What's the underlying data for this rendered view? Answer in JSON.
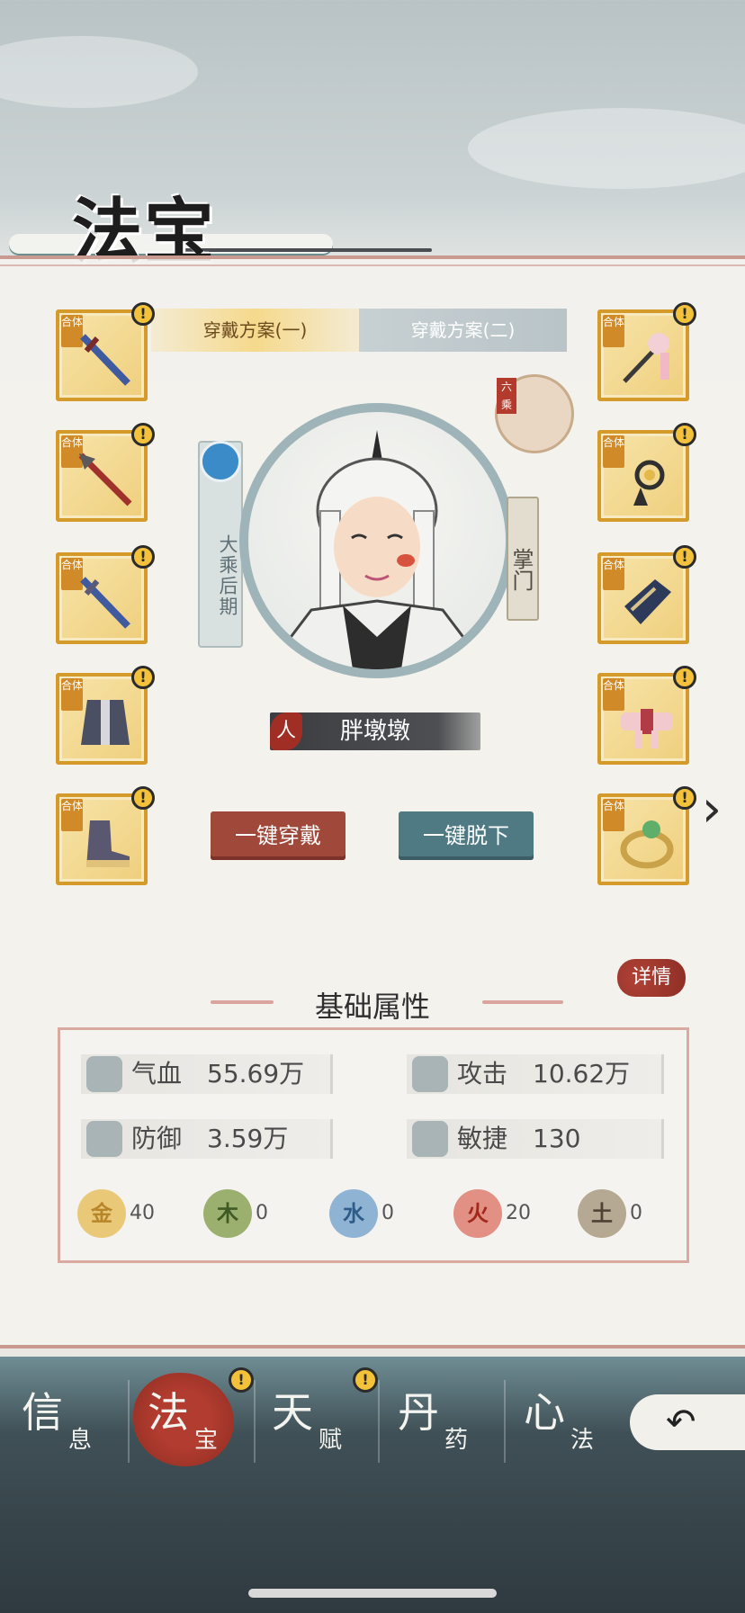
{
  "header": {
    "title": "法宝"
  },
  "plan_tabs": [
    {
      "label": "穿戴方案(一)",
      "active": true
    },
    {
      "label": "穿戴方案(二)",
      "active": false
    }
  ],
  "slots": {
    "tag": "合体",
    "alert": "!",
    "left": [
      {
        "icon": "sword-icon"
      },
      {
        "icon": "spear-icon"
      },
      {
        "icon": "sword-icon"
      },
      {
        "icon": "robe-icon"
      },
      {
        "icon": "boot-icon"
      }
    ],
    "right": [
      {
        "icon": "hairpin-icon"
      },
      {
        "icon": "pendant-icon"
      },
      {
        "icon": "bracer-icon"
      },
      {
        "icon": "belt-icon"
      },
      {
        "icon": "ring-icon"
      }
    ]
  },
  "character": {
    "realm": "大乘后期",
    "rank": "掌门",
    "race": "人",
    "name": "胖墩墩",
    "token_tag": "六乘"
  },
  "actions": {
    "equip_all": "一键穿戴",
    "unequip_all": "一键脱下"
  },
  "stats": {
    "title": "基础属性",
    "detail": "详情",
    "items": [
      {
        "label": "气血",
        "value": "55.69万",
        "icon": "blood-drop-icon"
      },
      {
        "label": "攻击",
        "value": "10.62万",
        "icon": "attack-icon"
      },
      {
        "label": "防御",
        "value": "3.59万",
        "icon": "shield-icon"
      },
      {
        "label": "敏捷",
        "value": "130",
        "icon": "wing-icon"
      }
    ],
    "elements": [
      {
        "glyph": "金",
        "value": "40",
        "color": "#e9c978"
      },
      {
        "glyph": "木",
        "value": "0",
        "color": "#9bb06e"
      },
      {
        "glyph": "水",
        "value": "0",
        "color": "#8fb4d3"
      },
      {
        "glyph": "火",
        "value": "20",
        "color": "#e28f84"
      },
      {
        "glyph": "土",
        "value": "0",
        "color": "#b5a993"
      }
    ]
  },
  "nav": [
    {
      "big": "信",
      "small": "息",
      "active": false,
      "alert": false
    },
    {
      "big": "法",
      "small": "宝",
      "active": true,
      "alert": true
    },
    {
      "big": "天",
      "small": "赋",
      "active": false,
      "alert": true
    },
    {
      "big": "丹",
      "small": "药",
      "active": false,
      "alert": false
    },
    {
      "big": "心",
      "small": "法",
      "active": false,
      "alert": false
    }
  ],
  "nav_alert": "!"
}
